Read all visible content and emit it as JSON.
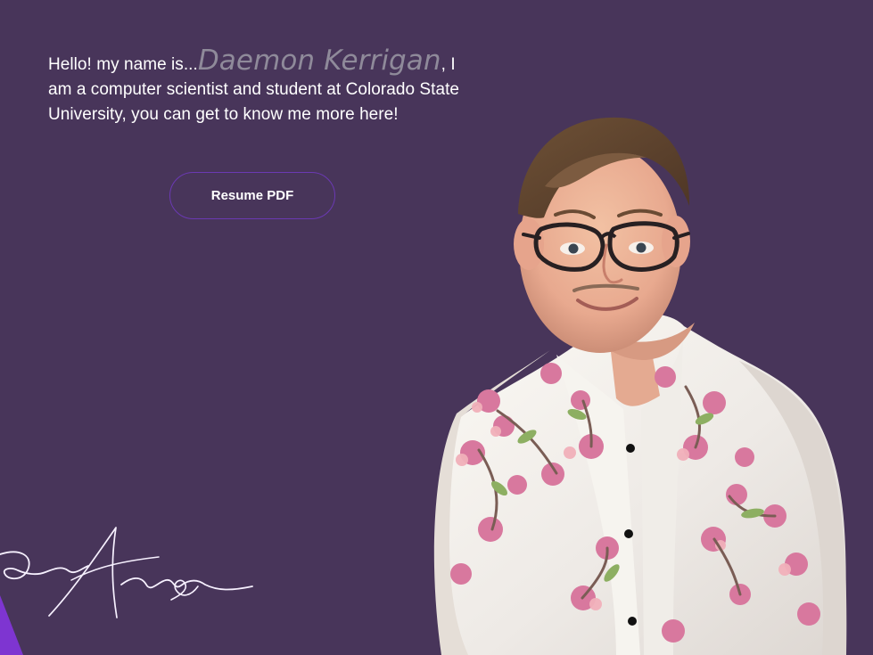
{
  "hero": {
    "intro_prefix": "Hello! my name is...",
    "name": "Daemon Kerrigan",
    "intro_suffix": ", I am a computer scientist and student at Colorado State University, you can get to know me more here!"
  },
  "resume_button": {
    "label": "Resume PDF"
  },
  "colors": {
    "background": "#48355a",
    "name_text": "#8f8a9a",
    "button_border": "#6b39b3",
    "accent": "#7e35d1",
    "shirt": "#f5f2ee",
    "flower_pink": "#d8789e"
  },
  "icons": {
    "signature": "signature-graphic",
    "portrait": "person-portrait-photo"
  }
}
